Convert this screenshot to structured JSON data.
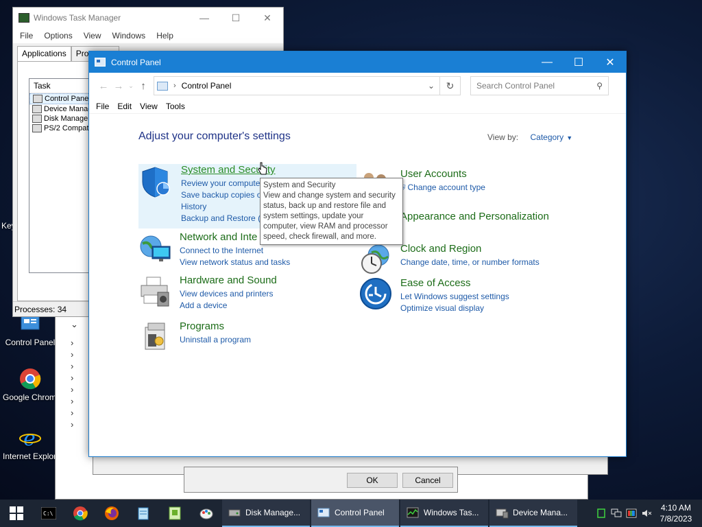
{
  "desktop": {
    "icons": [
      {
        "label": "Control Panel",
        "icon": "control-panel-icon"
      },
      {
        "label": "Google Chrome",
        "icon": "chrome-icon"
      },
      {
        "label": "Internet Explorer",
        "icon": "internet-explorer-icon"
      }
    ],
    "partial_left_label": "Key"
  },
  "dialog": {
    "ok": "OK",
    "cancel": "Cancel"
  },
  "task_manager": {
    "title": "Windows Task Manager",
    "menu": [
      "File",
      "Options",
      "View",
      "Windows",
      "Help"
    ],
    "tabs": [
      "Applications",
      "Processes"
    ],
    "column": "Task",
    "tasks": [
      "Control Panel",
      "Device Manager",
      "Disk Management",
      "PS/2 Compatible"
    ],
    "status": "Processes: 34"
  },
  "control_panel": {
    "title": "Control Panel",
    "address": "Control Panel",
    "search_placeholder": "Search Control Panel",
    "menu": [
      "File",
      "Edit",
      "View",
      "Tools"
    ],
    "heading": "Adjust your computer's settings",
    "view_by_label": "View by:",
    "view_by_value": "Category",
    "categories": [
      {
        "title": "System and Security",
        "links": [
          "Review your computer's status",
          "Save backup copies of your files with File History",
          "Backup and Restore (Windows 7)"
        ]
      },
      {
        "title": "Network and Internet",
        "links": [
          "Connect to the Internet",
          "View network status and tasks"
        ]
      },
      {
        "title": "Hardware and Sound",
        "links": [
          "View devices and printers",
          "Add a device"
        ]
      },
      {
        "title": "Programs",
        "links": [
          "Uninstall a program"
        ]
      },
      {
        "title": "User Accounts",
        "links": [
          "Change account type"
        ]
      },
      {
        "title": "Appearance and Personalization",
        "links": []
      },
      {
        "title": "Clock and Region",
        "links": [
          "Change date, time, or number formats"
        ]
      },
      {
        "title": "Ease of Access",
        "links": [
          "Let Windows suggest settings",
          "Optimize visual display"
        ]
      }
    ],
    "visible_link_text": {
      "sys1": "Review your compute",
      "sys2": "Save backup copies of",
      "sys3": "History",
      "sys4": "Backup and Restore (W",
      "net_title": "Network and Inte"
    },
    "tooltip": {
      "title": "System and Security",
      "body": "View and change system and security status, back up and restore file and system settings, update your computer, view RAM and processor speed, check firewall, and more."
    }
  },
  "taskbar": {
    "pinned": [
      "cmd-icon",
      "chrome-icon",
      "firefox-icon",
      "notepad-icon",
      "notepad-plus-icon",
      "paint-icon"
    ],
    "buttons": [
      {
        "label": "Disk Manage...",
        "active": false
      },
      {
        "label": "Control Panel",
        "active": true
      },
      {
        "label": "Windows Tas...",
        "active": false
      },
      {
        "label": "Device Mana...",
        "active": false
      }
    ],
    "time": "4:10 AM",
    "date": "7/8/2023"
  },
  "colors": {
    "titlebar": "#1a7fd4",
    "category_title": "#1c6c18",
    "link": "#1e5aa8",
    "heading": "#1e3287",
    "taskbar": "#1c2533"
  }
}
